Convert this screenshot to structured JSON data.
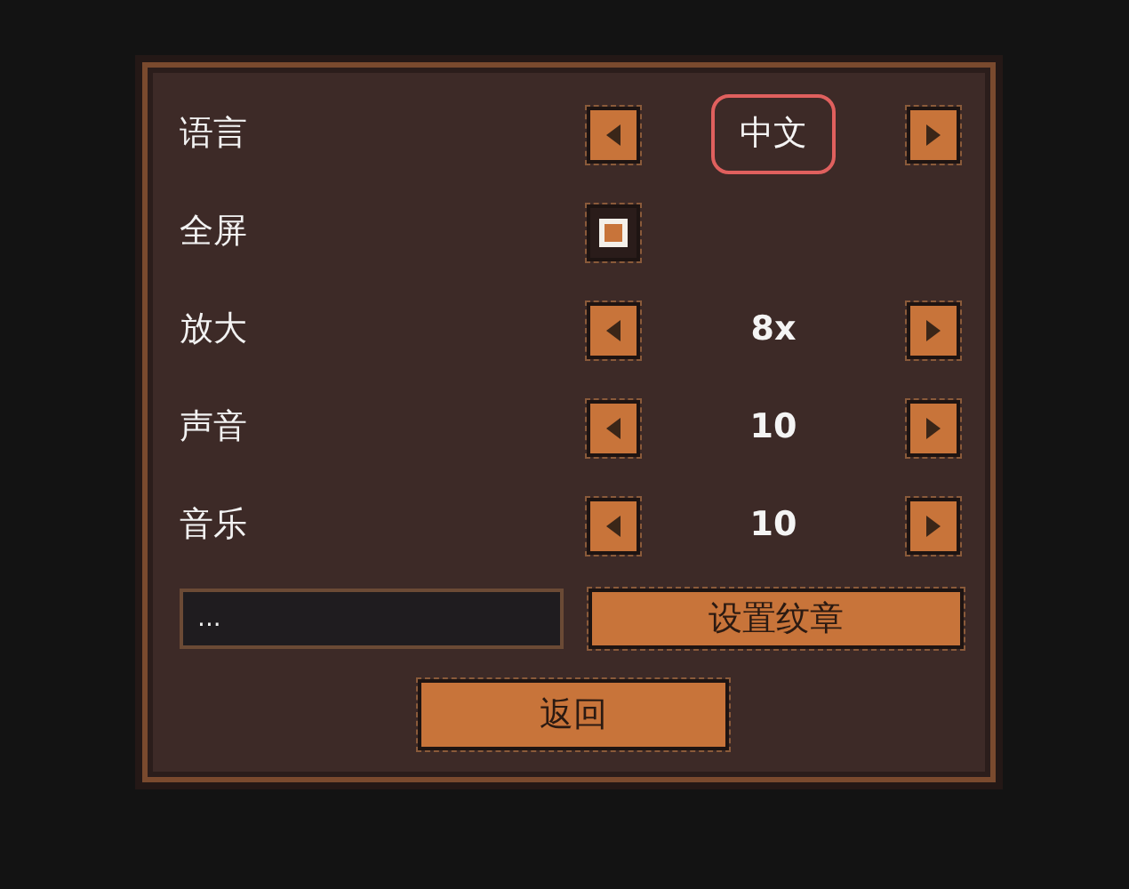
{
  "settings": [
    {
      "kind": "selector",
      "label": "语言",
      "value": "中文",
      "selected": true
    },
    {
      "kind": "checkbox",
      "label": "全屏",
      "checked": true,
      "selected": false
    },
    {
      "kind": "selector",
      "label": "放大",
      "value": "8x",
      "selected": false
    },
    {
      "kind": "selector",
      "label": "声音",
      "value": "10",
      "selected": false
    },
    {
      "kind": "selector",
      "label": "音乐",
      "value": "10",
      "selected": false
    }
  ],
  "emblem_field": {
    "value": "..."
  },
  "emblem_button": "设置纹章",
  "back_button": "返回"
}
